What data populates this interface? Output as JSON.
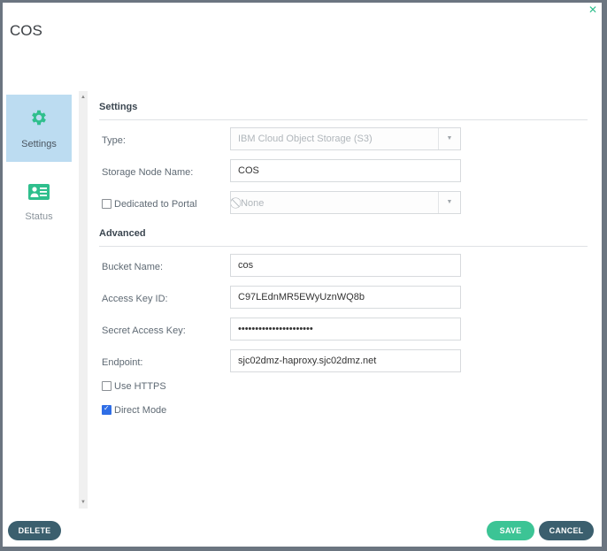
{
  "dialog": {
    "title": "COS",
    "close_icon": "close-x-icon"
  },
  "nav": {
    "items": [
      {
        "label": "Settings",
        "icon": "gear-icon",
        "active": true
      },
      {
        "label": "Status",
        "icon": "id-card-icon",
        "active": false
      }
    ]
  },
  "settings": {
    "section_title": "Settings",
    "type_label": "Type:",
    "type_value": "IBM Cloud Object Storage (S3)",
    "node_name_label": "Storage Node Name:",
    "node_name_value": "COS",
    "dedicated_label": "Dedicated to Portal",
    "dedicated_checked": false,
    "portal_value": "None",
    "portal_icon": "ban-icon"
  },
  "advanced": {
    "section_title": "Advanced",
    "bucket_label": "Bucket Name:",
    "bucket_value": "cos",
    "access_key_label": "Access Key ID:",
    "access_key_value": "C97LEdnMR5EWyUznWQ8b",
    "secret_label": "Secret Access Key:",
    "secret_value": "••••••••••••••••••••••",
    "endpoint_label": "Endpoint:",
    "endpoint_value": "sjc02dmz-haproxy.sjc02dmz.net",
    "https_label": "Use HTTPS",
    "https_checked": false,
    "direct_label": "Direct Mode",
    "direct_checked": true
  },
  "footer": {
    "delete_label": "DELETE",
    "save_label": "SAVE",
    "cancel_label": "CANCEL"
  },
  "colors": {
    "accent_green": "#3cc495",
    "dark_button": "#3b5f6e",
    "active_nav": "#bcdcf1",
    "checkbox_blue": "#2f6ee6"
  }
}
